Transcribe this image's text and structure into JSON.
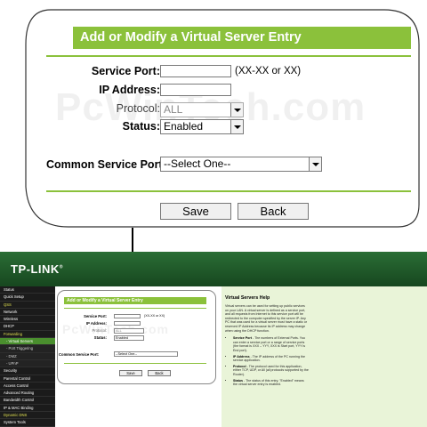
{
  "form": {
    "title": "Add or Modify a Virtual Server Entry",
    "service_port_label": "Service Port:",
    "service_port_value": "",
    "service_port_hint": "(XX-XX or XX)",
    "ip_address_label": "IP Address:",
    "ip_address_value": "",
    "protocol_label": "Protocol:",
    "protocol_value": "ALL",
    "status_label": "Status:",
    "status_value": "Enabled",
    "common_service_label": "Common Service Port:",
    "common_service_value": "--Select One--",
    "save_label": "Save",
    "back_label": "Back"
  },
  "brand": {
    "logo": "TP-LINK",
    "trademark": "®"
  },
  "watermark": "PcWinTech.com",
  "sidebar": {
    "items": [
      {
        "label": "Status",
        "style": "normal"
      },
      {
        "label": "Quick Setup",
        "style": "normal"
      },
      {
        "label": "QSS",
        "style": "highlight"
      },
      {
        "label": "Network",
        "style": "normal"
      },
      {
        "label": "Wireless",
        "style": "normal"
      },
      {
        "label": "DHCP",
        "style": "normal"
      },
      {
        "label": "Forwarding",
        "style": "highlight"
      },
      {
        "label": "- Virtual Servers",
        "style": "active"
      },
      {
        "label": "- Port Triggering",
        "style": "sub"
      },
      {
        "label": "- DMZ",
        "style": "sub"
      },
      {
        "label": "- UPnP",
        "style": "sub"
      },
      {
        "label": "Security",
        "style": "normal"
      },
      {
        "label": "Parental Control",
        "style": "normal"
      },
      {
        "label": "Access Control",
        "style": "normal"
      },
      {
        "label": "Advanced Routing",
        "style": "normal"
      },
      {
        "label": "Bandwidth Control",
        "style": "normal"
      },
      {
        "label": "IP & MAC Binding",
        "style": "normal"
      },
      {
        "label": "Dynamic DNS",
        "style": "highlight"
      },
      {
        "label": "System Tools",
        "style": "normal"
      }
    ]
  },
  "help": {
    "title": "Virtual Servers Help",
    "intro": "Virtual servers can be used for setting up public services on your LAN. A virtual server is defined as a service port, and all requests from Internet to this service port will be redirected to the computer specified by the server IP. Any PC that was used for a virtual server must have a static or reserved IP Address because its IP address may change when using the DHCP function.",
    "bullets": [
      {
        "term": "Service Port",
        "text": " - The numbers of External Ports. You can enter a service port or a range of service ports (the format is XXX – YYY, XXX is Start port, YYY is End port)."
      },
      {
        "term": "IP Address",
        "text": " - The IP address of the PC running the service application."
      },
      {
        "term": "Protocol",
        "text": " - The protocol used for this application, either TCP, UDP, or All (all protocols supported by the Router)."
      },
      {
        "term": "Status",
        "text": " - The status of this entry, \"Enabled\" means the virtual server entry is enabled."
      }
    ]
  },
  "colors": {
    "accent": "#8bc13b",
    "header": "#1f5b2c",
    "sidebar": "#1b1b1b",
    "help_bg": "#e9f4d8"
  }
}
